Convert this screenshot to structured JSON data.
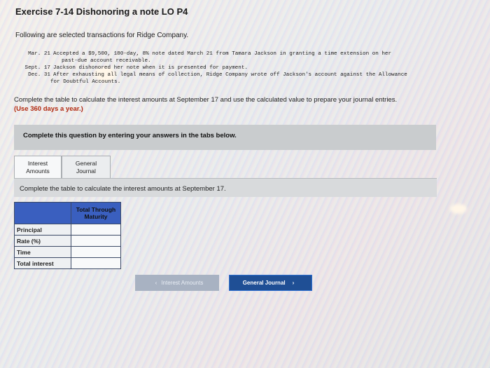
{
  "title": "Exercise 7-14 Dishonoring a note LO P4",
  "intro": "Following are selected transactions for Ridge Company.",
  "transactions": [
    {
      "date": "Mar. 21",
      "text": "Accepted a $9,500, 180-day, 8% note dated March 21 from Tamara Jackson in granting a time extension on her"
    },
    {
      "date": "",
      "text": "past-due account receivable."
    },
    {
      "date": "Sept. 17",
      "text": "Jackson dishonored her note when it is presented for payment."
    },
    {
      "date": "Dec. 31",
      "text": "After exhausting all legal means of collection, Ridge Company wrote off Jackson's account against the Allowance"
    },
    {
      "date": "",
      "text": "for Doubtful Accounts."
    }
  ],
  "instruction": "Complete the table to calculate the interest amounts at September 17 and use the calculated value to prepare your journal entries.",
  "instruction_note": "(Use 360 days a year.)",
  "panel_text": "Complete this question by entering your answers in the tabs below.",
  "tabs": [
    {
      "line1": "Interest",
      "line2": "Amounts"
    },
    {
      "line1": "General",
      "line2": "Journal"
    }
  ],
  "subpanel_text": "Complete the table to calculate the interest amounts at September 17.",
  "table": {
    "header_line1": "Total Through",
    "header_line2": "Maturity",
    "rows": [
      "Principal",
      "Rate (%)",
      "Time",
      "Total interest"
    ]
  },
  "buttons": {
    "prev": "Interest Amounts",
    "next": "General Journal"
  }
}
